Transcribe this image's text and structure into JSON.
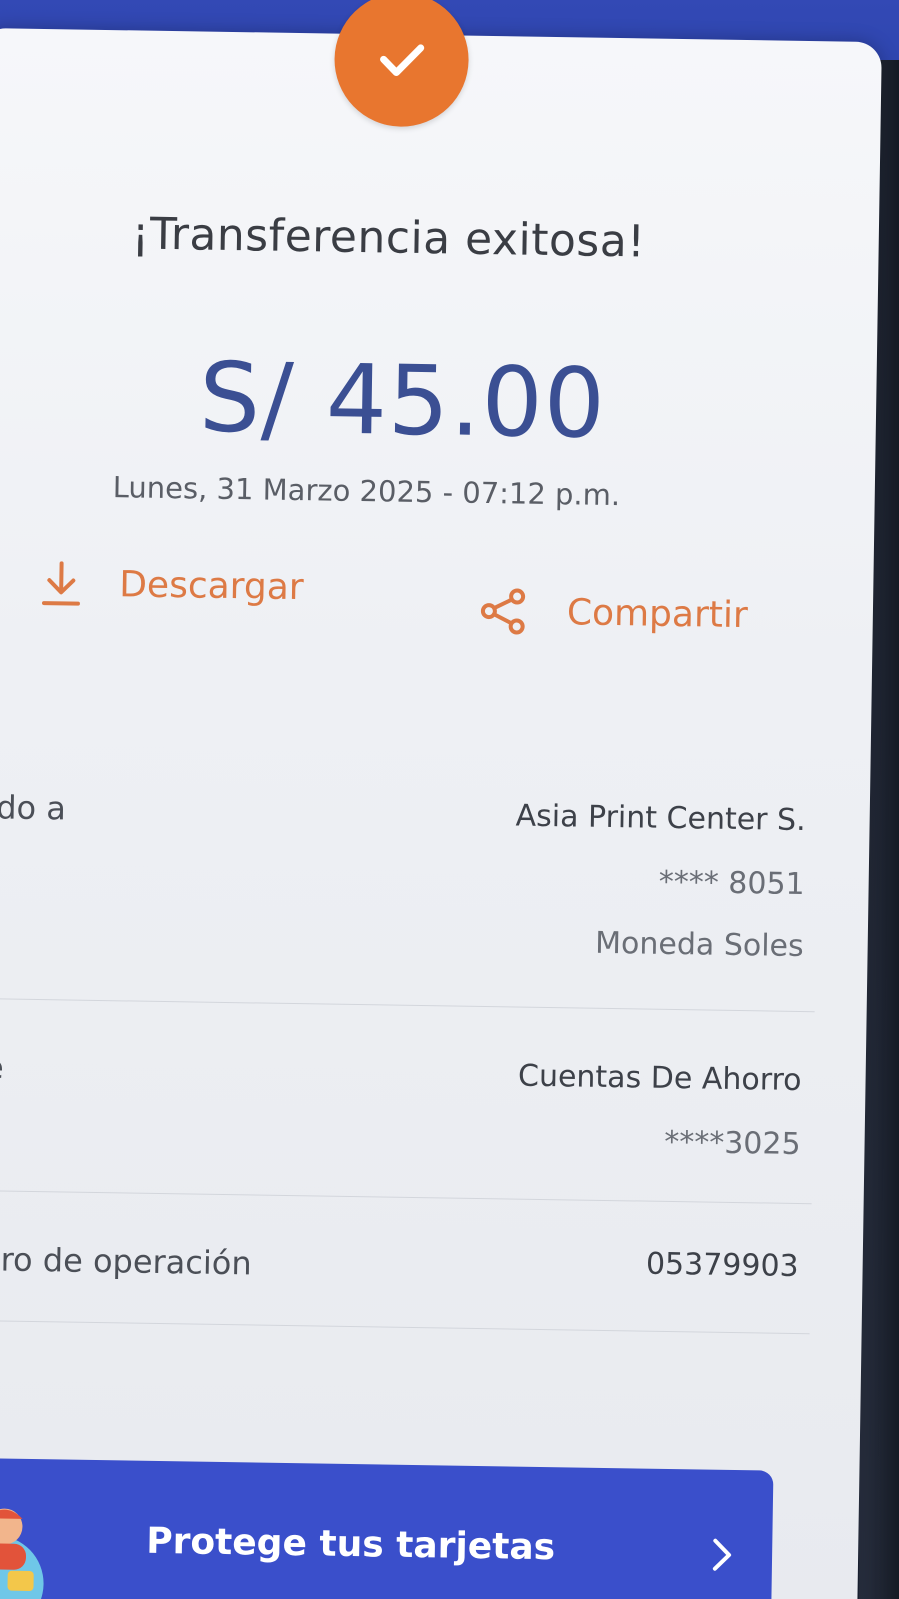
{
  "receipt": {
    "title": "¡Transferencia exitosa!",
    "amount": "S/ 45.00",
    "datetime": "Lunes, 31 Marzo 2025 - 07:12 p.m.",
    "status_icon": "check-icon",
    "accent_color": "#e8762f",
    "amount_color": "#3b4f93"
  },
  "actions": {
    "download_label": "Descargar",
    "download_icon": "download-icon",
    "share_label": "Compartir",
    "share_icon": "share-icon"
  },
  "details": {
    "sent_to": {
      "label": "iado a",
      "name": "Asia Print Center S.",
      "account": "**** 8051",
      "currency": "Moneda Soles"
    },
    "from": {
      "label": "de",
      "account_type": "Cuentas De Ahorro",
      "account": "****3025"
    },
    "operation": {
      "label": "nero de operación",
      "number": "05379903"
    }
  },
  "banner": {
    "label": "Protege tus tarjetas",
    "chevron_icon": "chevron-right-icon",
    "color": "#3a4fcb"
  }
}
